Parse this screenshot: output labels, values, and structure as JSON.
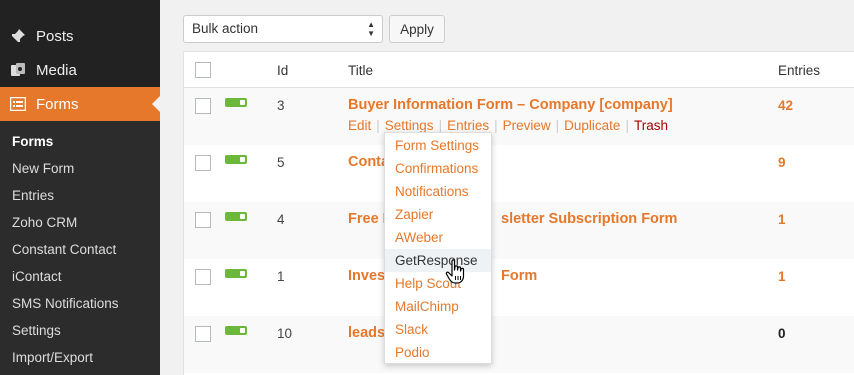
{
  "sidebar": {
    "menu": [
      {
        "label": "Posts",
        "icon": "pin-icon"
      },
      {
        "label": "Media",
        "icon": "media-icon"
      },
      {
        "label": "Forms",
        "icon": "forms-icon",
        "active": true
      }
    ],
    "submenu": [
      "Forms",
      "New Form",
      "Entries",
      "Zoho CRM",
      "Constant Contact",
      "iContact",
      "SMS Notifications",
      "Settings",
      "Import/Export"
    ]
  },
  "toolbar": {
    "bulk_action": "Bulk action",
    "apply_label": "Apply"
  },
  "table": {
    "headers": {
      "id": "Id",
      "title": "Title",
      "entries": "Entries"
    },
    "rows": [
      {
        "id": "3",
        "title": "Buyer Information Form – Company [company]",
        "entries": "42"
      },
      {
        "id": "5",
        "title": "Conta",
        "entries": "9"
      },
      {
        "id": "4",
        "title": "Free F",
        "title_tail": "sletter Subscription Form",
        "entries": "1"
      },
      {
        "id": "1",
        "title": "Invest",
        "title_tail": "Form",
        "entries": "1"
      },
      {
        "id": "10",
        "title": "leads",
        "entries": "0"
      }
    ],
    "row_actions": [
      "Edit",
      "Settings",
      "Entries",
      "Preview",
      "Duplicate",
      "Trash"
    ]
  },
  "settings_dropdown": {
    "items": [
      "Form Settings",
      "Confirmations",
      "Notifications",
      "Zapier",
      "AWeber",
      "GetResponse",
      "Help Scout",
      "MailChimp",
      "Slack",
      "Podio"
    ],
    "hovered": "GetResponse"
  },
  "colors": {
    "accent": "#e5782b",
    "sidebar_bg": "#222222",
    "active_toggle": "#6cb83a",
    "trash": "#aa0000"
  }
}
